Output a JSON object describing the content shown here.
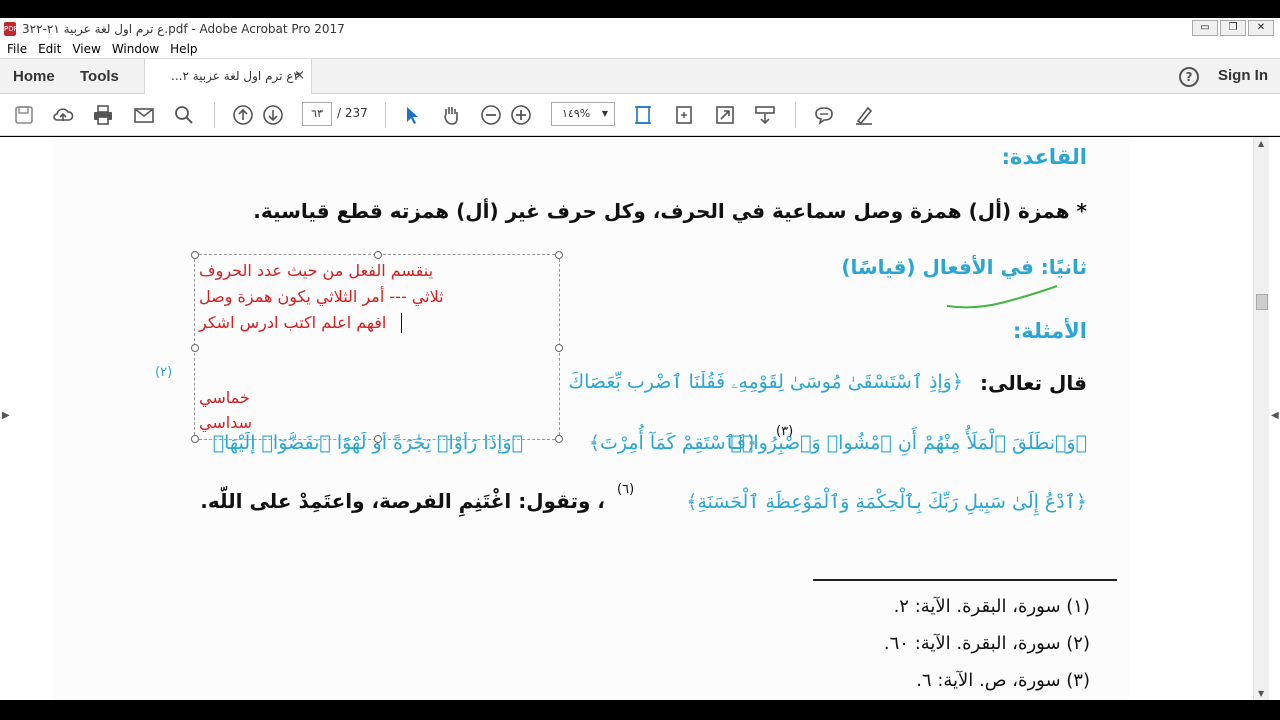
{
  "window": {
    "title": "3ع ترم اول لغة عربية ٢١-٢٢.pdf - Adobe Acrobat Pro 2017",
    "controls": [
      "▭",
      "❐",
      "✕"
    ]
  },
  "menu": [
    "File",
    "Edit",
    "View",
    "Window",
    "Help"
  ],
  "tabs": {
    "home": "Home",
    "tools": "Tools",
    "document": "٣ع ترم اول لغة عربية ٢...",
    "close": "×",
    "sign_in": "Sign In",
    "help": "?"
  },
  "toolbar": {
    "page_current": "٦٣",
    "page_total": "/ 237",
    "zoom": "١٤٩%"
  },
  "document": {
    "rule_heading": "القاعدة:",
    "rule_text": "* همزة (أل) همزة وصل سماعية في الحرف، وكل حرف غير (أل) همزته قطع قياسية.",
    "second_heading": "ثانيًا: في الأفعال (قياسًا)",
    "examples_heading": "الأمثلة:",
    "example1_prefix": "قال تعالى: ",
    "example1_verse": "﴿وَإِذِ ٱسْتَسْقَىٰ مُوسَىٰ لِقَوْمِهِۦ فَقُلْنَا ٱضْرِب بِّعَصَاكَ",
    "verse2": "﴿وَٱنطَلَقَ ٱلْمَلَأُ مِنْهُمْ أَنِ ٱمْشُوا۟ وَٱصْبِرُوا۟﴾",
    "verse2_ref": "(٣)",
    "verse3": "﴿فَٱسْتَقِمْ كَمَآ أُمِرْتَ﴾",
    "verse4": "﴿وَإِذَا رَأَوْا۟ تِجَٰرَةً أَوْ لَهْوًا ٱنفَضُّوٓا۟ إِلَيْهَا﴾",
    "verse5": "﴿ٱدْعُ إِلَىٰ سَبِيلِ رَبِّكَ بِٱلْحِكْمَةِ وَٱلْمَوْعِظَةِ ٱلْحَسَنَةِ﴾",
    "verse5_ref": "(٦)",
    "verse1_ref": "(٢)",
    "saying": "، وتقول: اغْتَنِمِ الفرصة، واعتَمِدْ على اللّه.",
    "footnotes": [
      "(١) سورة، البقرة. الآية: ٢.",
      "(٢) سورة، البقرة. الآية: ٦٠.",
      "(٣) سورة، ص. الآية: ٦."
    ]
  },
  "comment": {
    "lines": [
      "ينقسم الفعل من حيث عدد الحروف",
      "ثلاثي --- أمر الثلاثي يكون همزة وصل",
      "افهم اعلم اكتب ادرس اشكر"
    ],
    "extra": [
      "خماسي",
      "سداسي"
    ]
  }
}
